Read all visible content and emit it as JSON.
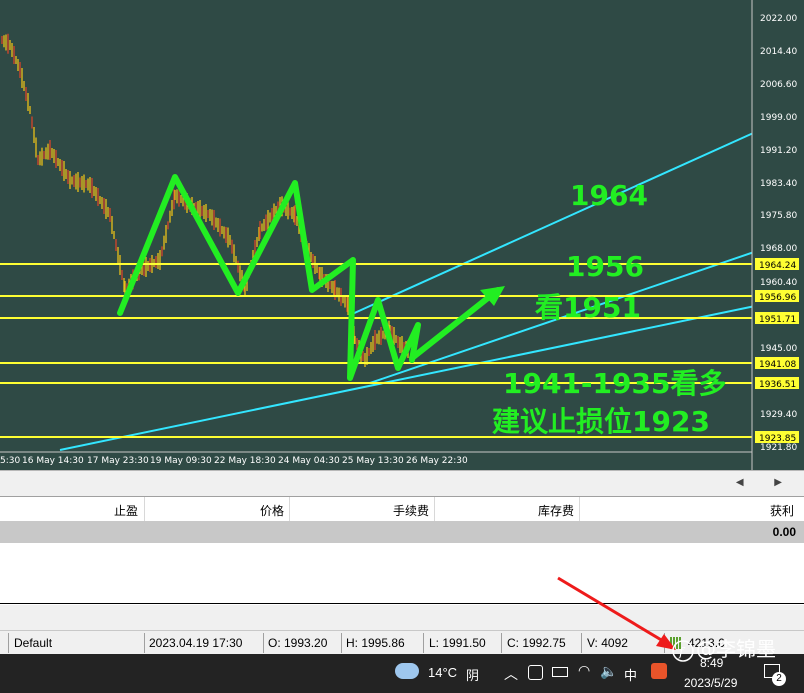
{
  "price_axis": [
    "2022.00",
    "2014.40",
    "2006.60",
    "1999.00",
    "1991.20",
    "1983.40",
    "1975.80",
    "1968.00",
    "1960.40",
    "1945.00",
    "1929.40",
    "1921.80"
  ],
  "level_boxes": [
    "1964.24",
    "1956.96",
    "1951.71",
    "1941.08",
    "1936.51",
    "1923.85"
  ],
  "time_axis": [
    "5:30",
    "16 May 14:30",
    "17 May 23:30",
    "19 May 09:30",
    "22 May 18:30",
    "24 May 04:30",
    "25 May 13:30",
    "26 May 22:30"
  ],
  "annotations": {
    "a1964": "1964",
    "a1956": "1956",
    "a1951": "看1951",
    "range": "1941-1935看多",
    "stop": "建议止损位1923"
  },
  "colors": {
    "chart_bg": "#2f4a45",
    "level_line": "#ffff33",
    "trend_line": "#33e6ff",
    "arrow": "#22ee22",
    "candle": "#e8c01a"
  },
  "scroll_arrows": "◀ ▶",
  "orders": {
    "columns": [
      "止盈",
      "价格",
      "手续费",
      "库存费",
      "获利"
    ],
    "balance_profit": "0.00"
  },
  "statusbar": {
    "profile": "Default",
    "datetime": "2023.04.19 17:30",
    "open": "O: 1993.20",
    "high": "H: 1995.86",
    "low": "L: 1991.50",
    "close": "C: 1992.75",
    "volume": "V: 4092",
    "traffic": "4213.6"
  },
  "taskbar": {
    "weather_temp": "14°C",
    "weather_desc": "阴",
    "ime": "中",
    "time": "8:49",
    "date": "2023/5/29",
    "notifications": "2",
    "watermark": "@李锦墨"
  }
}
